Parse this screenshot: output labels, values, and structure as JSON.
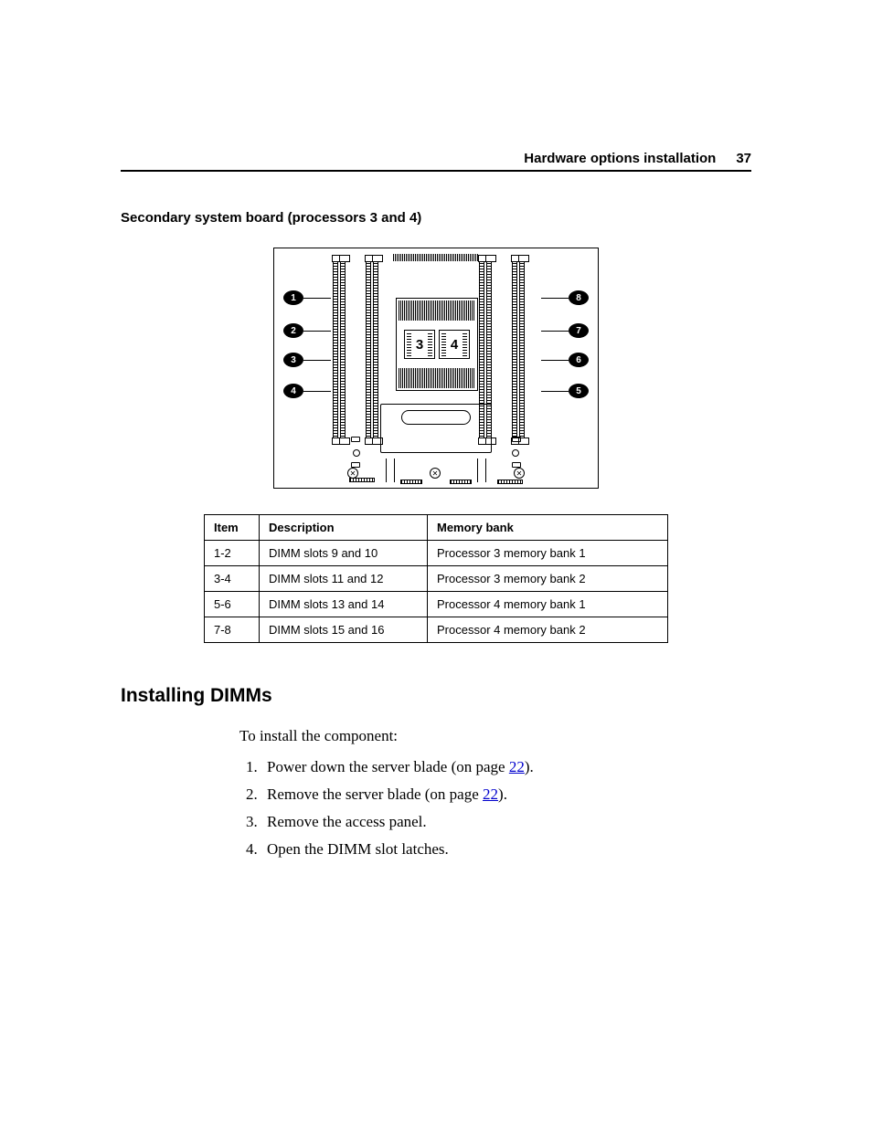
{
  "header": {
    "section": "Hardware options installation",
    "page": "37"
  },
  "subhead": "Secondary system board (processors 3 and 4)",
  "diagram": {
    "callouts": {
      "c1": "1",
      "c2": "2",
      "c3": "3",
      "c4": "4",
      "c5": "5",
      "c6": "6",
      "c7": "7",
      "c8": "8"
    },
    "cpu_left": "3",
    "cpu_right": "4"
  },
  "table": {
    "headers": {
      "item": "Item",
      "description": "Description",
      "memory_bank": "Memory bank"
    },
    "rows": [
      {
        "item": "1-2",
        "description": "DIMM slots 9 and 10",
        "memory_bank": "Processor 3 memory bank 1"
      },
      {
        "item": "3-4",
        "description": "DIMM slots 11 and 12",
        "memory_bank": "Processor 3 memory bank 2"
      },
      {
        "item": "5-6",
        "description": "DIMM slots 13 and 14",
        "memory_bank": "Processor 4 memory bank 1"
      },
      {
        "item": "7-8",
        "description": "DIMM slots 15 and 16",
        "memory_bank": "Processor 4 memory bank 2"
      }
    ]
  },
  "section_title": "Installing DIMMs",
  "intro": "To install the component:",
  "steps": {
    "s1_pre": "Power down the server blade (on page ",
    "s1_link": "22",
    "s1_post": ").",
    "s2_pre": "Remove the server blade (on page ",
    "s2_link": "22",
    "s2_post": ").",
    "s3": "Remove the access panel.",
    "s4": "Open the DIMM slot latches."
  }
}
